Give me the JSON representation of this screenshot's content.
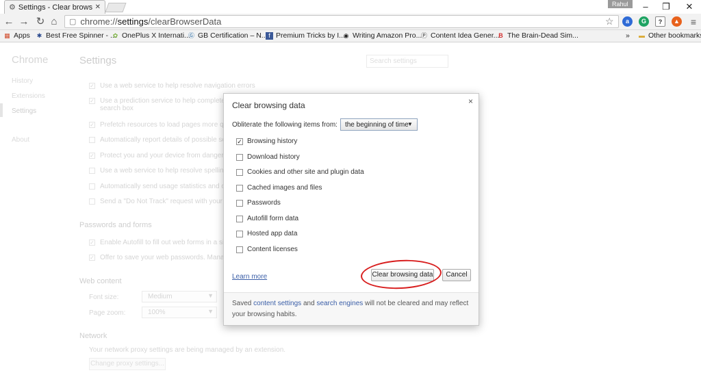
{
  "browser": {
    "tab_title": "Settings - Clear browsing",
    "profile_name": "Rahul",
    "url_scheme": "chrome://",
    "url_host": "settings",
    "url_path": "/clearBrowserData",
    "window_controls": [
      "–",
      "❐",
      "✕"
    ]
  },
  "bookmarks": {
    "apps_label": "Apps",
    "items": [
      "Best Free Spinner - ...",
      "OnePlus X Internati...",
      "GB Certification – N...",
      "Premium Tricks by I...",
      "Writing Amazon Pro...",
      "Content Idea Gener...",
      "The Brain-Dead Sim..."
    ],
    "overflow": "»",
    "other_label": "Other bookmarks"
  },
  "settings_page": {
    "logo": "Chrome",
    "nav": [
      "History",
      "Extensions",
      "Settings",
      "About"
    ],
    "title": "Settings",
    "search_placeholder": "Search settings",
    "privacy_options": [
      "Use a web service to help resolve navigation errors",
      "Use a prediction service to help complete sear",
      "search box",
      "Prefetch resources to load pages more quickl",
      "Automatically report details of possible secur",
      "Protect you and your device from dangerous",
      "Use a web service to help resolve spelling err",
      "Automatically send usage statistics and crash",
      "Send a \"Do Not Track\" request with your bro"
    ],
    "passwords_title": "Passwords and forms",
    "passwords_options": [
      "Enable Autofill to fill out web forms in a singl",
      "Offer to save your web passwords. Manage p"
    ],
    "web_content_title": "Web content",
    "font_size_label": "Font size:",
    "font_size_value": "Medium",
    "page_zoom_label": "Page zoom:",
    "page_zoom_value": "100%",
    "network_title": "Network",
    "network_text": "Your network proxy settings are being managed by an extension.",
    "proxy_button": "Change proxy settings..."
  },
  "dialog": {
    "title": "Clear browsing data",
    "close": "×",
    "obliterate_label": "Obliterate the following items from:",
    "time_range": "the beginning of time",
    "items": [
      {
        "label": "Browsing history",
        "checked": true
      },
      {
        "label": "Download history",
        "checked": false
      },
      {
        "label": "Cookies and other site and plugin data",
        "checked": false
      },
      {
        "label": "Cached images and files",
        "checked": false
      },
      {
        "label": "Passwords",
        "checked": false
      },
      {
        "label": "Autofill form data",
        "checked": false
      },
      {
        "label": "Hosted app data",
        "checked": false
      },
      {
        "label": "Content licenses",
        "checked": false
      }
    ],
    "learn_more": "Learn more",
    "clear_button": "Clear browsing data",
    "cancel_button": "Cancel",
    "footer_pre": "Saved ",
    "footer_link1": "content settings",
    "footer_mid": " and ",
    "footer_link2": "search engines",
    "footer_post": " will not be cleared and may reflect your browsing habits."
  },
  "colors": {
    "highlight_ring": "#d81e1e",
    "link": "#3a5ea7"
  }
}
